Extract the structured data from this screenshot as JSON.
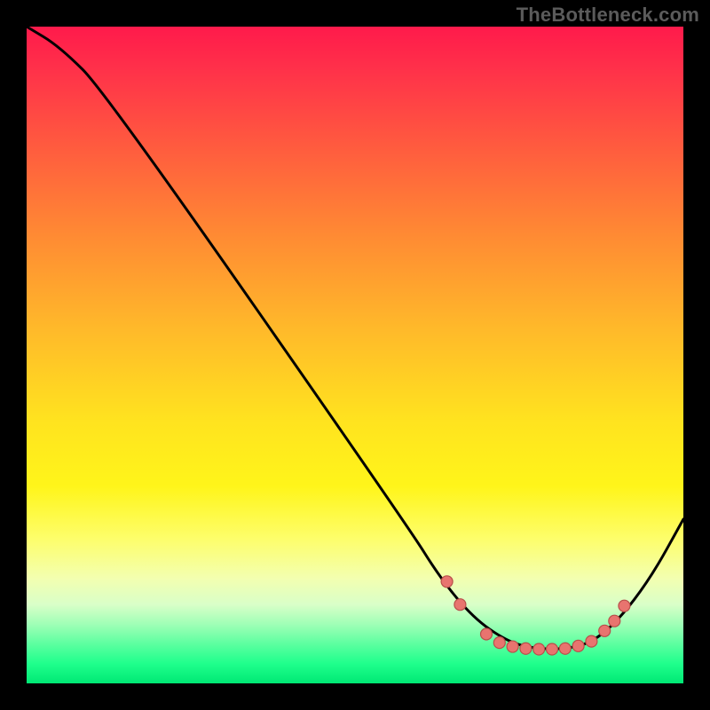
{
  "watermark": "TheBottleneck.com",
  "colors": {
    "frame": "#000000",
    "curve": "#000000",
    "marker_fill": "#e8746f",
    "marker_stroke": "#b84f4a"
  },
  "chart_data": {
    "type": "line",
    "title": "",
    "xlabel": "",
    "ylabel": "",
    "xlim": [
      0,
      100
    ],
    "ylim": [
      0,
      100
    ],
    "grid": false,
    "legend": false,
    "curve_points": [
      {
        "x": 0,
        "y": 100
      },
      {
        "x": 5,
        "y": 97
      },
      {
        "x": 12,
        "y": 90
      },
      {
        "x": 58,
        "y": 24
      },
      {
        "x": 63,
        "y": 16
      },
      {
        "x": 68,
        "y": 10
      },
      {
        "x": 73,
        "y": 6.5
      },
      {
        "x": 77,
        "y": 5.3
      },
      {
        "x": 82,
        "y": 5.2
      },
      {
        "x": 86,
        "y": 6.2
      },
      {
        "x": 90,
        "y": 9.5
      },
      {
        "x": 95,
        "y": 16
      },
      {
        "x": 100,
        "y": 25
      }
    ],
    "markers": [
      {
        "x": 64,
        "y": 15.5
      },
      {
        "x": 66,
        "y": 12.0
      },
      {
        "x": 70,
        "y": 7.5
      },
      {
        "x": 72,
        "y": 6.2
      },
      {
        "x": 74,
        "y": 5.6
      },
      {
        "x": 76,
        "y": 5.3
      },
      {
        "x": 78,
        "y": 5.2
      },
      {
        "x": 80,
        "y": 5.2
      },
      {
        "x": 82,
        "y": 5.3
      },
      {
        "x": 84,
        "y": 5.7
      },
      {
        "x": 86,
        "y": 6.4
      },
      {
        "x": 88,
        "y": 8.0
      },
      {
        "x": 89.5,
        "y": 9.5
      },
      {
        "x": 91,
        "y": 11.8
      }
    ]
  }
}
